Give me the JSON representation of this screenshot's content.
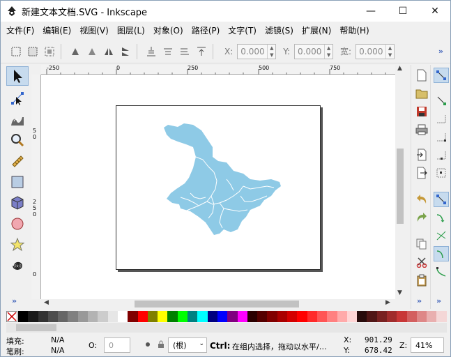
{
  "window": {
    "title": "新建文本文档.SVG - Inkscape",
    "minimize": "—",
    "maximize": "☐",
    "close": "✕"
  },
  "menu": [
    "文件(F)",
    "编辑(E)",
    "视图(V)",
    "图层(L)",
    "对象(O)",
    "路径(P)",
    "文字(T)",
    "滤镜(S)",
    "扩展(N)",
    "帮助(H)"
  ],
  "toolbar": {
    "x_label": "X:",
    "x_value": "0.000",
    "y_label": "Y:",
    "y_value": "0.000",
    "w_label": "宽:",
    "w_value": "0.000",
    "more": "»"
  },
  "rulers": {
    "top_ticks": [
      "-250",
      "0",
      "250",
      "500",
      "750"
    ],
    "left_ticks": [
      "50",
      "250",
      "0"
    ]
  },
  "tools": [
    "selector-tool",
    "node-tool",
    "tweak-tool",
    "zoom-tool",
    "measure-tool",
    "rectangle-tool",
    "3d-box-tool",
    "ellipse-tool",
    "star-tool",
    "spiral-tool"
  ],
  "tools_more": "»",
  "commands_more": "»",
  "snap_more": "»",
  "map": {
    "fill": "#8ecae6",
    "stroke": "#ffffff"
  },
  "palette": [
    "#000000",
    "#1a1a1a",
    "#333333",
    "#4d4d4d",
    "#666666",
    "#808080",
    "#999999",
    "#b3b3b3",
    "#cccccc",
    "#e6e6e6",
    "#ffffff",
    "#800000",
    "#ff0000",
    "#808000",
    "#ffff00",
    "#008000",
    "#00ff00",
    "#008080",
    "#00ffff",
    "#000080",
    "#0000ff",
    "#800080",
    "#ff00ff",
    "#2b0000",
    "#550000",
    "#800000",
    "#aa0000",
    "#d40000",
    "#ff0000",
    "#ff2a2a",
    "#ff5555",
    "#ff8080",
    "#ffaaaa",
    "#ffd5d5",
    "#280b0b",
    "#501616",
    "#782121",
    "#a02c2c",
    "#c83737",
    "#d35f5f",
    "#de8787",
    "#e9afaf",
    "#f4d7d7"
  ],
  "status": {
    "fill_label": "填充:",
    "fill_value": "N/A",
    "stroke_label": "笔刷:",
    "stroke_value": "N/A",
    "opacity_label": "O:",
    "opacity_value": "0",
    "layer": "(根)",
    "message_bold": "Ctrl:",
    "message": "在组内选择，拖动以水平/…",
    "cursor_x_label": "X:",
    "cursor_x": "901.29",
    "cursor_y_label": "Y:",
    "cursor_y": "678.42",
    "zoom_label": "Z:",
    "zoom": "41%"
  }
}
